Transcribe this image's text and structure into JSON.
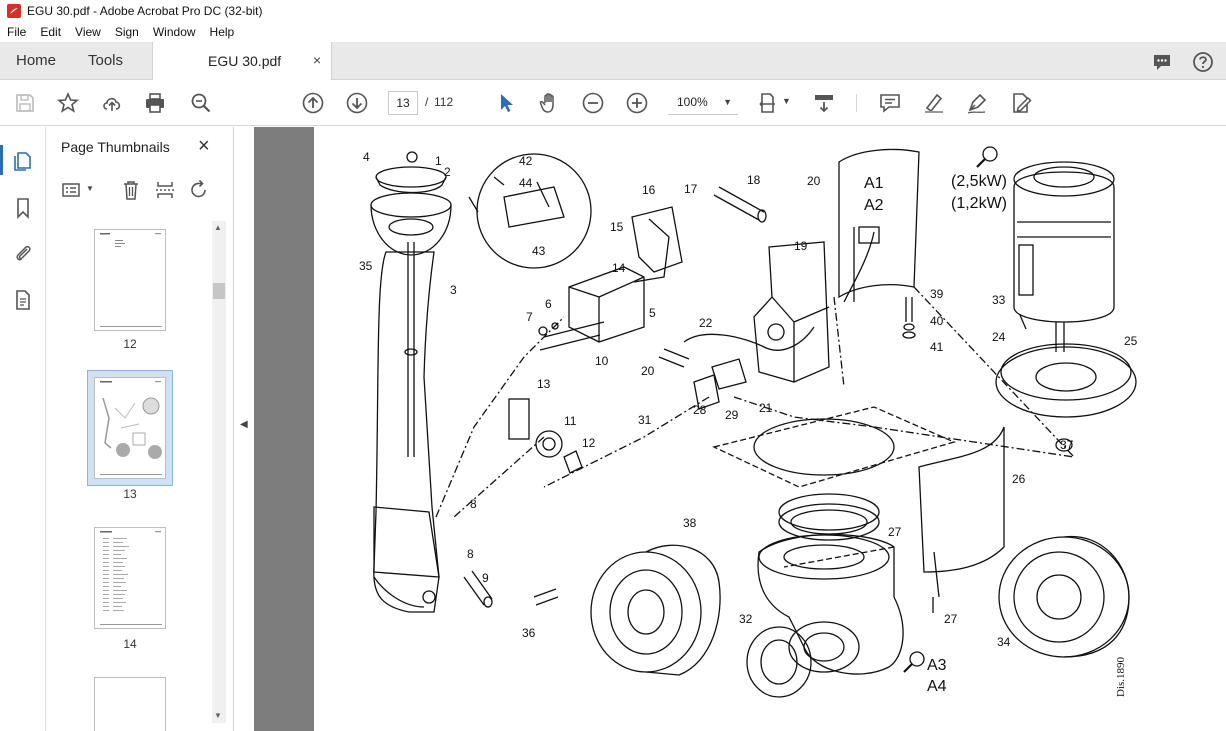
{
  "window": {
    "title": "EGU 30.pdf - Adobe Acrobat Pro DC (32-bit)"
  },
  "menu": [
    "File",
    "Edit",
    "View",
    "Sign",
    "Window",
    "Help"
  ],
  "tabs": {
    "home": "Home",
    "tools": "Tools",
    "document": "EGU 30.pdf",
    "close": "×"
  },
  "toolbar": {
    "page_current": "13",
    "page_sep": "/",
    "page_total": "112",
    "zoom": "100%"
  },
  "sidebar": {
    "title": "Page Thumbnails",
    "close": "×",
    "thumbnails": [
      {
        "label": "12"
      },
      {
        "label": "13",
        "selected": true
      },
      {
        "label": "14"
      }
    ]
  },
  "drawing": {
    "labels": [
      "1",
      "2",
      "3",
      "4",
      "5",
      "6",
      "7",
      "8",
      "8",
      "9",
      "10",
      "11",
      "12",
      "13",
      "14",
      "15",
      "16",
      "17",
      "18",
      "19",
      "20",
      "21",
      "22",
      "23",
      "24",
      "25",
      "26",
      "27",
      "28",
      "29",
      "30",
      "31",
      "32",
      "33",
      "34",
      "35",
      "36",
      "37",
      "38",
      "39",
      "40",
      "41",
      "42",
      "43",
      "44"
    ],
    "power_a": "(2,5kW)",
    "power_b": "(1,2kW)",
    "ref_a1": "A1",
    "ref_a2": "A2",
    "ref_a3": "A3",
    "ref_a4": "A4",
    "drawing_no": "Dis.1890"
  },
  "colors": {
    "accent": "#2a6ebb",
    "pdf_red": "#d4302b",
    "doc_bg": "#7d7d7d"
  }
}
